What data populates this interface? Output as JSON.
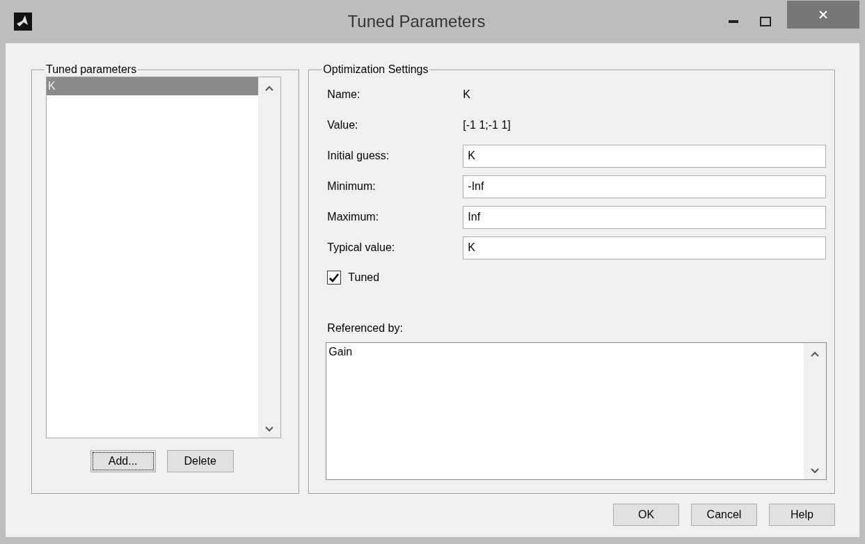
{
  "window": {
    "title": "Tuned Parameters"
  },
  "tuned_parameters": {
    "title": "Tuned parameters",
    "items": [
      {
        "label": "K",
        "selected": true
      }
    ],
    "buttons": [
      {
        "label": "Add...",
        "focused": true
      },
      {
        "label": "Delete",
        "focused": false
      }
    ]
  },
  "optimization_settings": {
    "title": "Optimization Settings",
    "info": [
      {
        "label": "Name:",
        "value": "K"
      },
      {
        "label": "Value:",
        "value": "[-1 1;-1 1]"
      }
    ],
    "fields": [
      {
        "label": "Initial guess:",
        "value": "K"
      },
      {
        "label": "Minimum:",
        "value": "-Inf"
      },
      {
        "label": "Maximum:",
        "value": "Inf"
      },
      {
        "label": "Typical value:",
        "value": "K"
      }
    ],
    "tuned": {
      "label": "Tuned",
      "checked": true
    },
    "referenced_by": {
      "label": "Referenced by:",
      "text": "Gain"
    }
  },
  "buttons": [
    {
      "label": "OK"
    },
    {
      "label": "Cancel"
    },
    {
      "label": "Help"
    }
  ]
}
